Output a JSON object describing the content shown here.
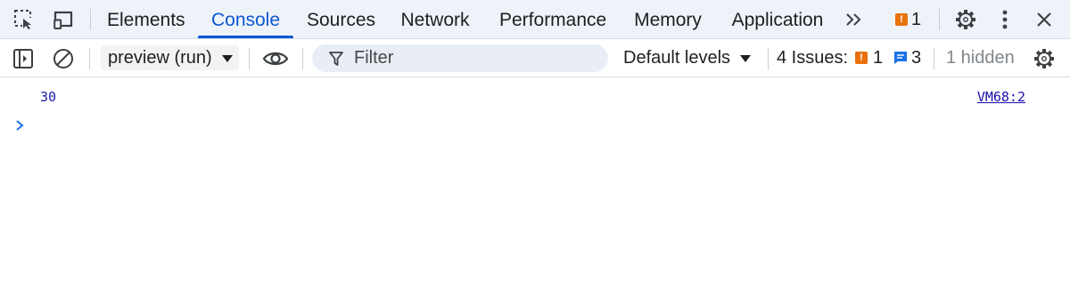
{
  "colors": {
    "accent": "#0b57d0",
    "issue_error": "#e8710a",
    "issue_info": "#1a73e8",
    "tabbar_bg": "#eef2f9",
    "number_value": "#1a1aa6"
  },
  "tabbar": {
    "icons": [
      "inspect-element-icon",
      "device-toolbar-icon",
      "more-tabs-chevron-icon",
      "settings-gear-icon",
      "kebab-menu-icon",
      "close-icon"
    ],
    "tabs": [
      {
        "label": "Elements",
        "active": false
      },
      {
        "label": "Console",
        "active": true
      },
      {
        "label": "Sources",
        "active": false
      },
      {
        "label": "Network",
        "active": false
      },
      {
        "label": "Performance",
        "active": false
      },
      {
        "label": "Memory",
        "active": false
      },
      {
        "label": "Application",
        "active": false
      }
    ],
    "more_tabs_symbol": ">>",
    "issues_badge_count": "1"
  },
  "toolbar": {
    "context_select": "preview (run)",
    "filter_placeholder": "Filter",
    "levels_label": "Default levels",
    "issues_label": "4 Issues:",
    "issues_error_count": "1",
    "issues_info_count": "3",
    "hidden_label": "1 hidden"
  },
  "console": {
    "messages": [
      {
        "value": "30",
        "source": "VM68:2"
      }
    ],
    "prompt_symbol": ">"
  }
}
